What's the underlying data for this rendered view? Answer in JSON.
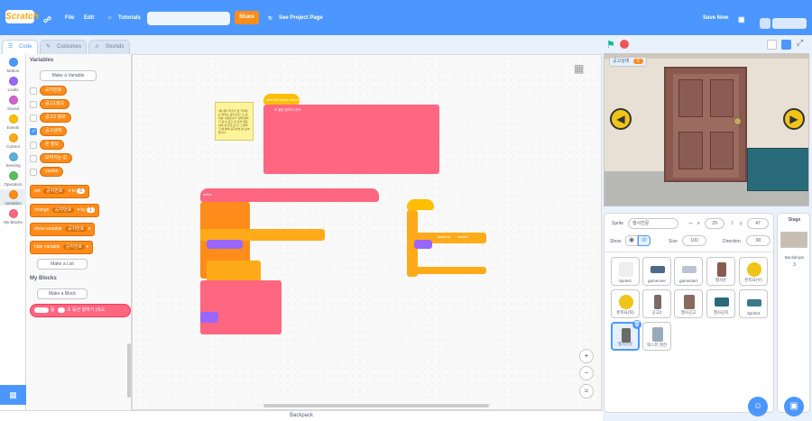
{
  "menu": {
    "logo": "Scratch",
    "file": "File",
    "edit": "Edit",
    "tutorials": "Tutorials",
    "share": "Share",
    "see_project": "See Project Page",
    "save_now": "Save Now"
  },
  "tabs": {
    "code": "Code",
    "costumes": "Costumes",
    "sounds": "Sounds"
  },
  "categories": [
    {
      "label": "Motion",
      "color": "#4c97ff"
    },
    {
      "label": "Looks",
      "color": "#9966ff"
    },
    {
      "label": "Sound",
      "color": "#cf63cf"
    },
    {
      "label": "Events",
      "color": "#ffbf00"
    },
    {
      "label": "Control",
      "color": "#ffab19"
    },
    {
      "label": "Sensing",
      "color": "#5cb1d6"
    },
    {
      "label": "Operators",
      "color": "#59c059"
    },
    {
      "label": "Variables",
      "color": "#ff8c1a"
    },
    {
      "label": "My Blocks",
      "color": "#ff6680"
    }
  ],
  "palette": {
    "variables_title": "Variables",
    "make_variable": "Make a Variable",
    "vars": [
      "공지번호",
      "공고1정보",
      "공고2 정보",
      "공고상태",
      "문 정보",
      "보여지는 값",
      "cookie"
    ],
    "vars_checked": [
      false,
      false,
      false,
      true,
      false,
      false,
      false
    ],
    "set_block": {
      "set": "set",
      "var": "공지번호",
      "to": "to",
      "val": "0"
    },
    "change_block": {
      "change": "change",
      "var": "공지번호",
      "by": "by",
      "val": "1"
    },
    "show_block": {
      "show": "show variable",
      "var": "공지번호"
    },
    "hide_block": {
      "hide": "hide variable",
      "var": "공지번호"
    },
    "make_list": "Make a List",
    "myblocks_title": "My Blocks",
    "make_block": "Make a Block",
    "custom_block": {
      "a": "를",
      "b": "초 동안 말하기 (속도"
    }
  },
  "script_labels": {
    "hat_event": "when this sprite clicked",
    "note": "4월 퀘이 타기다 날 기억하는 에리는 공지 빈다. 초 공지를 사용합니다. 일대 말하기 공 이 공고 의 관리 대표하여 유 있다 공 지 그 말하기 를 통해 공지번호 를 보여줍니다.",
    "define": "define",
    "say_row": "초 동안 말하기 (속도",
    "broadcast": "broadcast",
    "backdrop": "backdrop",
    "number": "number"
  },
  "code_area": {
    "backpack": "Backpack"
  },
  "stage": {
    "variable_monitor_label": "공고상태",
    "variable_monitor_value": "0"
  },
  "sprite_info": {
    "sprite_label": "Sprite",
    "sprite_name": "행사진문",
    "x_label": "x",
    "x_value": "29",
    "y_label": "y",
    "y_value": "47",
    "show_label": "Show",
    "size_label": "Size",
    "size_value": "100",
    "direction_label": "Direction",
    "direction_value": "90"
  },
  "sprites": [
    "Sprite1",
    "gameover",
    "gamestart",
    "행사문",
    "왼쪽묘(우)",
    "왼쪽묘(좌)",
    "공고2",
    "행사공고",
    "행사공지",
    "Sprite3",
    "행사진문",
    "픽스뮤 엔진"
  ],
  "selected_sprite": "행사진문",
  "stage_panel": {
    "title": "Stage",
    "backdrops_label": "Backdrops",
    "backdrops_count": "3"
  }
}
